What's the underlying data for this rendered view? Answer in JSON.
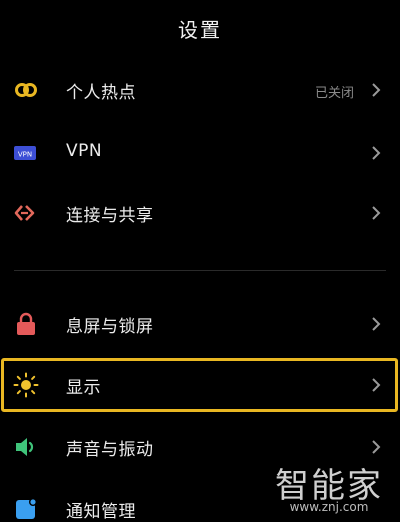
{
  "header": {
    "title": "设置"
  },
  "items": [
    {
      "id": "hotspot",
      "label": "个人热点",
      "value": "已关闭",
      "icon": "hotspot-icon"
    },
    {
      "id": "vpn",
      "label": "VPN",
      "icon": "vpn-icon",
      "icon_text": "VPN"
    },
    {
      "id": "connect-share",
      "label": "连接与共享",
      "icon": "connection-share-icon"
    },
    {
      "id": "lockscreen",
      "label": "息屏与锁屏",
      "icon": "lock-icon"
    },
    {
      "id": "display",
      "label": "显示",
      "icon": "sun-icon",
      "highlighted": true
    },
    {
      "id": "sound",
      "label": "声音与振动",
      "icon": "speaker-icon"
    },
    {
      "id": "notifications",
      "label": "通知管理",
      "icon": "notification-icon"
    }
  ],
  "watermark": {
    "text": "智能家",
    "url": "www.znj.com"
  },
  "colors": {
    "background": "#000000",
    "highlight": "#e9b722",
    "hotspot": "#e9b722",
    "vpn": "#3d4fd6",
    "connect": "#e2685b",
    "lock": "#e45a5a",
    "sun": "#f0c22e",
    "sound": "#3fc47a",
    "notify": "#3a9ff0"
  }
}
